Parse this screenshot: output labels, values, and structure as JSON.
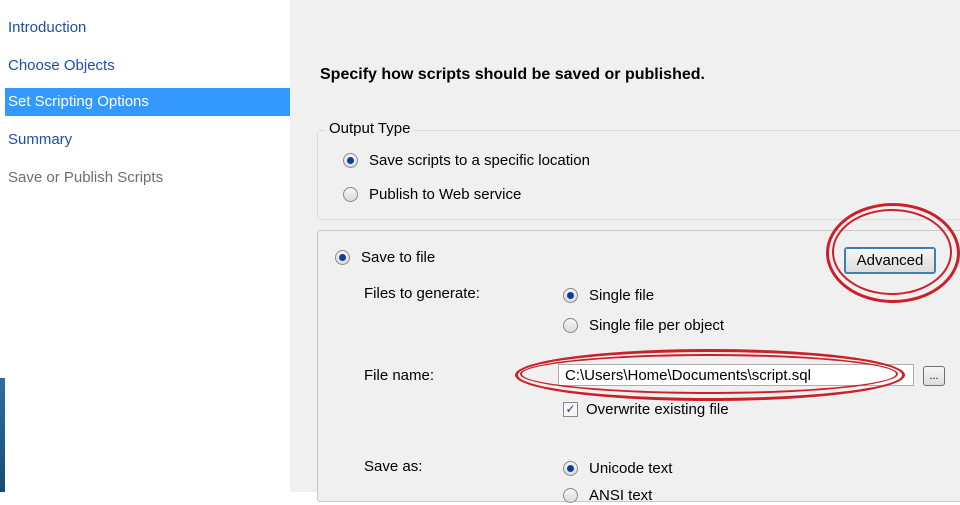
{
  "sidebar": {
    "items": [
      {
        "label": "Introduction",
        "state": "link"
      },
      {
        "label": "Choose Objects",
        "state": "link"
      },
      {
        "label": "Set Scripting Options",
        "state": "selected"
      },
      {
        "label": "Summary",
        "state": "link"
      },
      {
        "label": "Save or Publish Scripts",
        "state": "disabled"
      }
    ]
  },
  "main": {
    "heading": "Specify how scripts should be saved or published.",
    "output_type": {
      "legend": "Output Type",
      "options": [
        {
          "label": "Save scripts to a specific location",
          "checked": true
        },
        {
          "label": "Publish to Web service",
          "checked": false
        }
      ]
    },
    "save_to_file": {
      "label": "Save to file",
      "checked": true,
      "advanced_label": "Advanced",
      "files_to_generate": {
        "label": "Files to generate:",
        "options": [
          {
            "label": "Single file",
            "checked": true
          },
          {
            "label": "Single file per object",
            "checked": false
          }
        ]
      },
      "file_name": {
        "label": "File name:",
        "value": "C:\\Users\\Home\\Documents\\script.sql",
        "browse_label": "..."
      },
      "overwrite": {
        "label": "Overwrite existing file",
        "checked": true,
        "mark": "✓"
      },
      "save_as": {
        "label": "Save as:",
        "options": [
          {
            "label": "Unicode text",
            "checked": true
          },
          {
            "label": "ANSI text",
            "checked": false
          }
        ]
      }
    }
  },
  "annotation_color": "#cc2029",
  "selection_color": "#3399ff"
}
